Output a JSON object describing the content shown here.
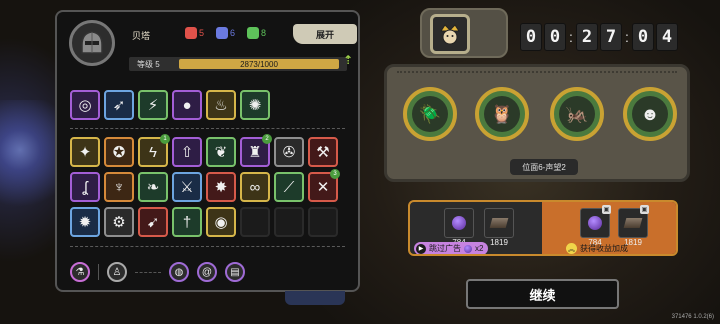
{
  "player": {
    "name": "贝塔",
    "counters": [
      {
        "value": "5",
        "color": "#e0524a",
        "icon": "red-mask-icon"
      },
      {
        "value": "6",
        "color": "#6b7ae0",
        "icon": "blue-mask-icon"
      },
      {
        "value": "8",
        "color": "#5ec25a",
        "icon": "green-mask-icon"
      }
    ],
    "expand_label": "展开",
    "level_label": "等级 5",
    "exp_text": "2873/1000",
    "exp_fraction": 1.0
  },
  "skills": {
    "row1": [
      {
        "icon": "eye-target-icon",
        "frame": "purple",
        "glyph": "◎"
      },
      {
        "icon": "spear-icon",
        "frame": "blue",
        "glyph": "➶"
      },
      {
        "icon": "claw-icon",
        "frame": "green",
        "glyph": "⚡"
      },
      {
        "icon": "bear-icon",
        "frame": "purple",
        "glyph": "●"
      },
      {
        "icon": "flame-bars-icon",
        "frame": "gold",
        "glyph": "♨"
      },
      {
        "icon": "vortex-icon",
        "frame": "green",
        "glyph": "✺"
      }
    ],
    "row2": [
      {
        "icon": "wings-icon",
        "frame": "gold",
        "glyph": "✦"
      },
      {
        "icon": "spin-icon",
        "frame": "orange",
        "glyph": "✪"
      },
      {
        "icon": "lightning-icon",
        "frame": "gold",
        "glyph": "ϟ",
        "badge": "1"
      },
      {
        "icon": "arrow-up-icon",
        "frame": "purple",
        "glyph": "⇧"
      },
      {
        "icon": "feather-icon",
        "frame": "green",
        "glyph": "❦"
      },
      {
        "icon": "tower-icon",
        "frame": "purple",
        "glyph": "♜",
        "badge": "2"
      },
      {
        "icon": "compass-icon",
        "frame": "grey",
        "glyph": "✇"
      },
      {
        "icon": "axe-icon",
        "frame": "red",
        "glyph": "⚒"
      }
    ],
    "row3": [
      {
        "icon": "hook-icon",
        "frame": "purple",
        "glyph": "ʆ"
      },
      {
        "icon": "torch-icon",
        "frame": "orange",
        "glyph": "♆"
      },
      {
        "icon": "leaf-icon",
        "frame": "green",
        "glyph": "❧"
      },
      {
        "icon": "blade-icon",
        "frame": "blue",
        "glyph": "⚔"
      },
      {
        "icon": "beast-icon",
        "frame": "red",
        "glyph": "✸"
      },
      {
        "icon": "chain-icon",
        "frame": "gold",
        "glyph": "∞"
      },
      {
        "icon": "slash-icon",
        "frame": "green",
        "glyph": "⟋"
      },
      {
        "icon": "swords-icon",
        "frame": "red",
        "glyph": "✕",
        "badge": "3"
      }
    ],
    "row4": [
      {
        "icon": "orb-icon",
        "frame": "blue",
        "glyph": "✹"
      },
      {
        "icon": "gear-icon",
        "frame": "grey",
        "glyph": "⚙"
      },
      {
        "icon": "feather-spark-icon",
        "frame": "red",
        "glyph": "➹"
      },
      {
        "icon": "dagger-icon",
        "frame": "green",
        "glyph": "†"
      },
      {
        "icon": "coin-icon",
        "frame": "gold",
        "glyph": "◉"
      },
      {
        "icon": "empty",
        "frame": "empty",
        "glyph": ""
      },
      {
        "icon": "empty",
        "frame": "empty",
        "glyph": ""
      },
      {
        "icon": "empty",
        "frame": "empty",
        "glyph": ""
      }
    ]
  },
  "bottom_icons": [
    "potion-icon",
    "figure-icon",
    "pearl-icon",
    "at-sign-icon",
    "scroll-icon"
  ],
  "timer": {
    "digits": [
      "00",
      "27",
      "04"
    ],
    "hero_icon": "crowned-hero-icon"
  },
  "stage": {
    "label": "位面6-声望2",
    "bosses": [
      "beetle-boss-icon",
      "armored-bird-boss-icon",
      "insect-boss-icon",
      "hooded-ghoul-boss-icon"
    ]
  },
  "rewards": {
    "left": [
      {
        "icon": "purple-gem-icon",
        "value": "784"
      },
      {
        "icon": "ingot-icon",
        "value": "1819"
      }
    ],
    "right": [
      {
        "icon": "purple-gem-icon",
        "value": "784"
      },
      {
        "icon": "ingot-icon",
        "value": "1819"
      }
    ],
    "ad_label": "跳过广告",
    "ad_multiplier": "x2",
    "bonus_label": "获得收益加成"
  },
  "continue_label": "继续",
  "version": "371476 1.0.2(6)"
}
